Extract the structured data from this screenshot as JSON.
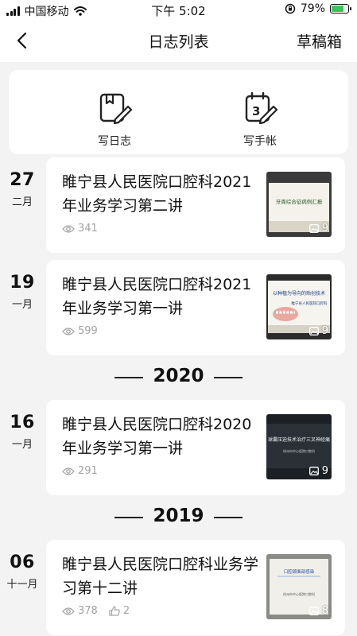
{
  "status": {
    "carrier": "中国移动",
    "time": "下午 5:02",
    "battery": "79%",
    "battery_level": 0.79
  },
  "nav": {
    "title": "日志列表",
    "draft": "草稿箱"
  },
  "actions": {
    "diary": "写日志",
    "handbook": "写手帐"
  },
  "entries": [
    {
      "day": "27",
      "month": "二月",
      "title": "睢宁县人民医院口腔科2021年业务学习第二讲",
      "views": "341",
      "images": "9",
      "thumb_text": "牙周综合征病例汇报"
    },
    {
      "day": "19",
      "month": "一月",
      "title": "睢宁县人民医院口腔科2021年业务学习第一讲",
      "views": "599",
      "images": "9",
      "thumb_text": "以种植为导向的殆创技术",
      "thumb_sub": "睢宁县人民医院口腔科"
    },
    {
      "day": "16",
      "month": "一月",
      "title": "睢宁县人民医院口腔科2020年业务学习第一讲",
      "views": "291",
      "images": "9",
      "thumb_text": "球囊压迫技术治疗三叉神经痛",
      "thumb_sub": "徐州市中心医院口腔科"
    },
    {
      "day": "06",
      "month": "十一月",
      "title": "睢宁县人民医院口腔科业务学习第十二讲",
      "views": "378",
      "likes": "2",
      "images": "8",
      "thumb_text": "口腔颌面部感染",
      "thumb_sub": "徐州市中心医院口腔科"
    }
  ],
  "years": [
    "2020",
    "2019"
  ],
  "colors": {
    "meta": "#a3a3a3",
    "background": "#f3f3f3",
    "card": "#ffffff"
  }
}
